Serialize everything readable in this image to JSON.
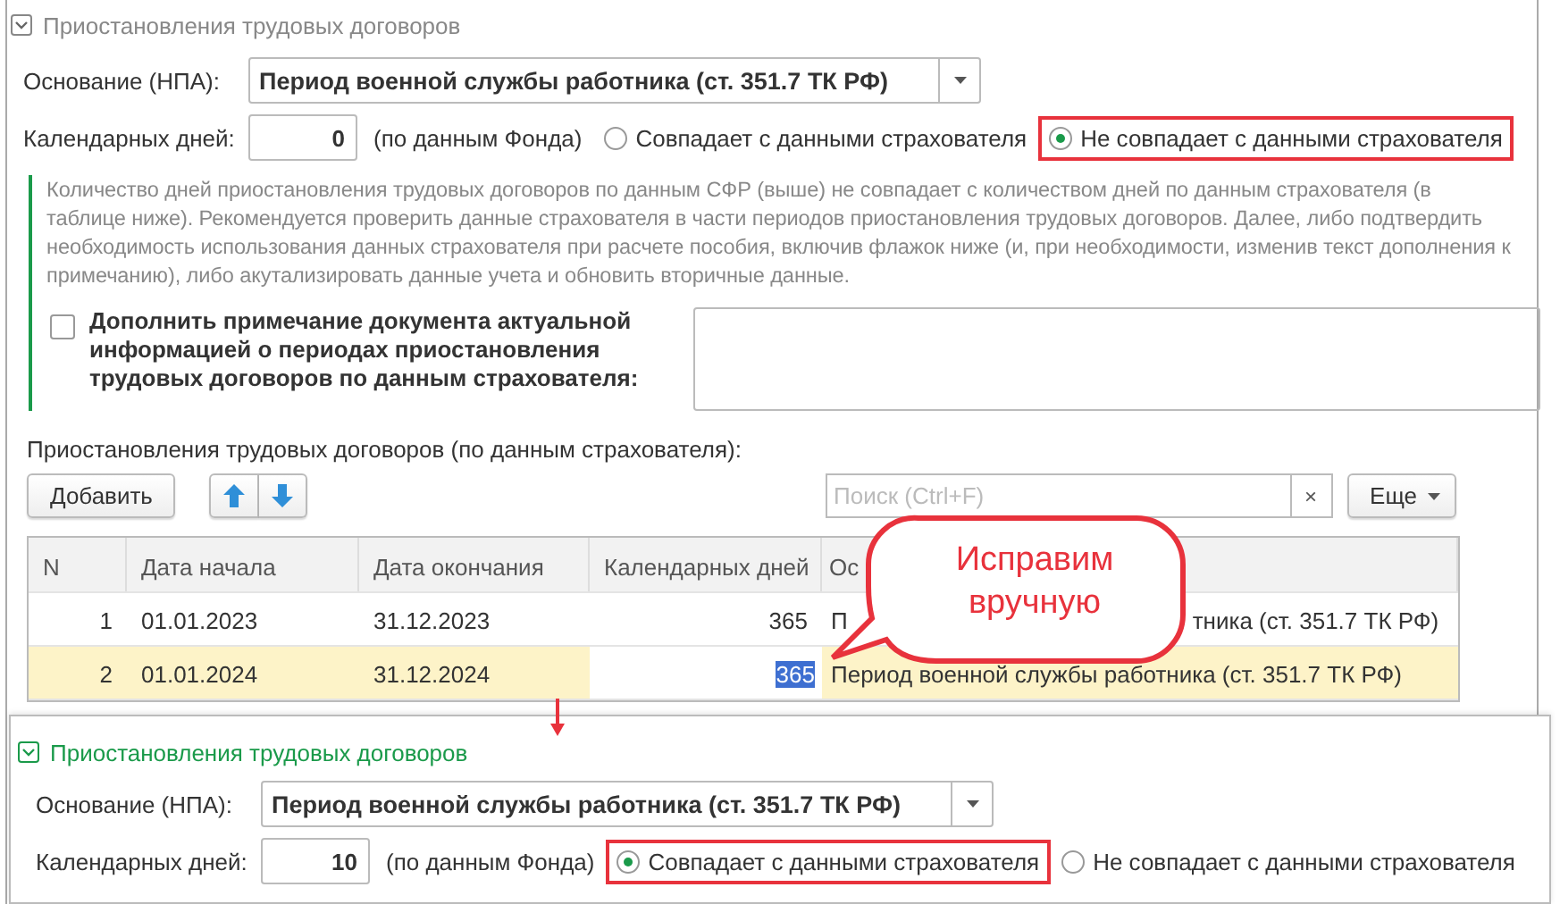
{
  "top_panel": {
    "title": "Приостановления трудовых договоров",
    "expanded": true,
    "active": false,
    "basis_label": "Основание (НПА):",
    "basis_value": "Период военной службы работника (ст. 351.7 ТК РФ)",
    "days_label": "Календарных дней:",
    "days_value": "0",
    "days_note": "(по данным Фонда)",
    "radios": [
      {
        "label": "Совпадает с данными страхователя",
        "selected": false,
        "highlighted": false
      },
      {
        "label": "Не совпадает с данными страхователя",
        "selected": true,
        "highlighted": true
      }
    ],
    "info_text": "Количество дней приостановления трудовых договоров по данным СФР (выше) не совпадает с количеством дней по данным страхователя (в таблице ниже). Рекомендуется проверить данные страхователя в части периодов приостановления трудовых договоров. Далее, либо подтвердить необходимость использования данных страхователя при расчете пособия, включив флажок ниже (и, при необходимости, изменив текст дополнения к примечанию), либо акутализировать данные учета и обновить вторичные данные.",
    "checkbox": {
      "label": "Дополнить примечание документа актуальной информацией о периодах приостановления трудовых договоров по данным страхователя:",
      "checked": false
    },
    "table_label": "Приостановления трудовых договоров (по данным страхователя):",
    "add_button": "Добавить",
    "search": {
      "placeholder": "Поиск (Ctrl+F)",
      "clear": "×"
    },
    "more_button": "Еще",
    "table": {
      "columns": [
        "N",
        "Дата начала",
        "Дата окончания",
        "Календарных дней",
        "Ос"
      ],
      "rows": [
        {
          "n": "1",
          "start": "01.01.2023",
          "end": "31.12.2023",
          "days": "365",
          "basis_parts": [
            "П",
            "тника (ст. 351.7 ТК РФ)"
          ],
          "selected": false,
          "editing": false
        },
        {
          "n": "2",
          "start": "01.01.2024",
          "end": "31.12.2024",
          "days": "365",
          "basis_parts": [
            "Период военной службы работника (ст. 351.7 ТК РФ)"
          ],
          "selected": true,
          "editing": true
        }
      ]
    }
  },
  "callout": {
    "text": "Исправим вручную"
  },
  "bottom_panel": {
    "title": "Приостановления трудовых договоров",
    "expanded": true,
    "active": true,
    "basis_label": "Основание (НПА):",
    "basis_value": "Период военной службы работника (ст. 351.7 ТК РФ)",
    "days_label": "Календарных дней:",
    "days_value": "10",
    "days_note": "(по данным Фонда)",
    "radios": [
      {
        "label": "Совпадает с данными страхователя",
        "selected": true,
        "highlighted": true
      },
      {
        "label": "Не совпадает с данными страхователя",
        "selected": false,
        "highlighted": false
      }
    ]
  }
}
